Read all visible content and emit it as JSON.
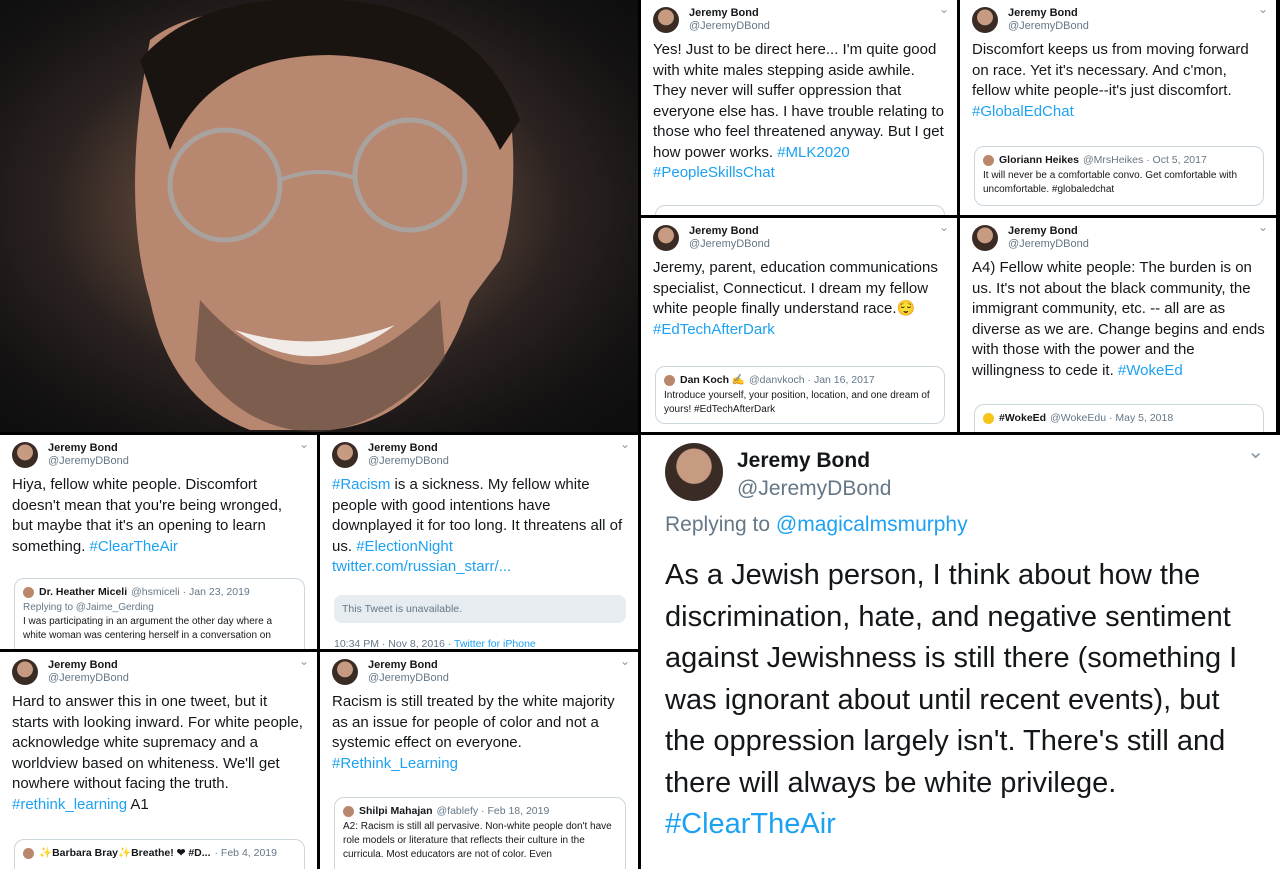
{
  "photo": {
    "icon": "person-photo"
  },
  "tweets": [
    {
      "name": "Jeremy Bond",
      "handle": "@JeremyDBond",
      "text": "Yes! Just to be direct here... I'm quite good with white males stepping aside awhile. They never will suffer oppression that everyone else has. I have trouble relating to those who feel threatened anyway. But I get how power works. ",
      "tags": "#MLK2020 #PeopleSkillsChat"
    },
    {
      "name": "Jeremy Bond",
      "handle": "@JeremyDBond",
      "text": "Discomfort keeps us from moving forward on race. Yet it's necessary. And c'mon, fellow white people--it's just discomfort. ",
      "tags": "#GlobalEdChat",
      "quote": {
        "name": "Gloriann Heikes",
        "handle": "@MrsHeikes · Oct 5, 2017",
        "text": "It will never be a comfortable convo. Get comfortable with uncomfortable. #globaledchat"
      }
    },
    {
      "name": "Jeremy Bond",
      "handle": "@JeremyDBond",
      "text": "Jeremy, parent, education communications specialist, Connecticut. I dream my fellow white people finally understand race.😌 ",
      "tags": "#EdTechAfterDark",
      "quote": {
        "name": "Dan Koch ✍",
        "handle": "@danvkoch · Jan 16, 2017",
        "text": "Introduce yourself, your position, location, and one dream of yours! #EdTechAfterDark"
      }
    },
    {
      "name": "Jeremy Bond",
      "handle": "@JeremyDBond",
      "text": "A4) Fellow white people: The burden is on us. It's not about the black community, the immigrant community, etc. -- all are as diverse as we are. Change begins and ends with those with the power and the willingness to cede it. ",
      "tags": "#WokeEd",
      "quote": {
        "name": "#WokeEd",
        "handle": "@WokeEdu · May 5, 2018",
        "text": ""
      }
    },
    {
      "name": "Jeremy Bond",
      "handle": "@JeremyDBond",
      "text": "Hiya, fellow white people. Discomfort doesn't mean that you're being wronged, but maybe that it's an opening to learn something. ",
      "tags": "#ClearTheAir",
      "quote": {
        "name": "Dr. Heather Miceli",
        "handle": "@hsmiceli · Jan 23, 2019",
        "reply": "Replying to @Jaime_Gerding",
        "text": "I was participating in an argument the other day where a white woman was centering herself in a conversation on"
      }
    },
    {
      "name": "Jeremy Bond",
      "handle": "@JeremyDBond",
      "lead_tag": "#Racism",
      "text": " is a sickness. My fellow white people with good intentions have downplayed it for too long. It threatens all of us. ",
      "tags": "#ElectionNight",
      "link": "twitter.com/russian_starr/...",
      "unavailable": "This Tweet is unavailable.",
      "meta_time": "10:34 PM · Nov 8, 2016 · ",
      "meta_src": "Twitter for iPhone"
    },
    {
      "name": "Jeremy Bond",
      "handle": "@JeremyDBond",
      "text": "Hard to answer this in one tweet, but it starts with looking inward. For white people, acknowledge white supremacy and a worldview based on whiteness. We'll get nowhere without facing the truth. ",
      "tags": "#rethink_learning",
      "suffix": " A1",
      "quote": {
        "name": "✨Barbara Bray✨Breathe! ❤ #D...",
        "handle": "· Feb 4, 2019",
        "text": ""
      }
    },
    {
      "name": "Jeremy Bond",
      "handle": "@JeremyDBond",
      "text": "Racism is still treated by the white majority as an issue for people of color and not a systemic effect on everyone. ",
      "tags": "#Rethink_Learning",
      "quote": {
        "name": "Shilpi Mahajan",
        "handle": "@fablefy · Feb 18, 2019",
        "text": "A2: Racism is still all pervasive. Non-white people don't have role models or literature that reflects their culture in the curricula. Most educators are not of color. Even"
      }
    }
  ],
  "big": {
    "name": "Jeremy Bond",
    "handle": "@JeremyDBond",
    "reply_prefix": "Replying to ",
    "reply_to": "@magicalmsmurphy",
    "text": "As a Jewish person, I think about how the discrimination, hate, and negative sentiment against Jewishness is still there (something I was ignorant about until recent events), but the oppression largely isn't. There's still and there will always be white privilege. ",
    "tags": "#ClearTheAir"
  },
  "chevron": "⌄"
}
